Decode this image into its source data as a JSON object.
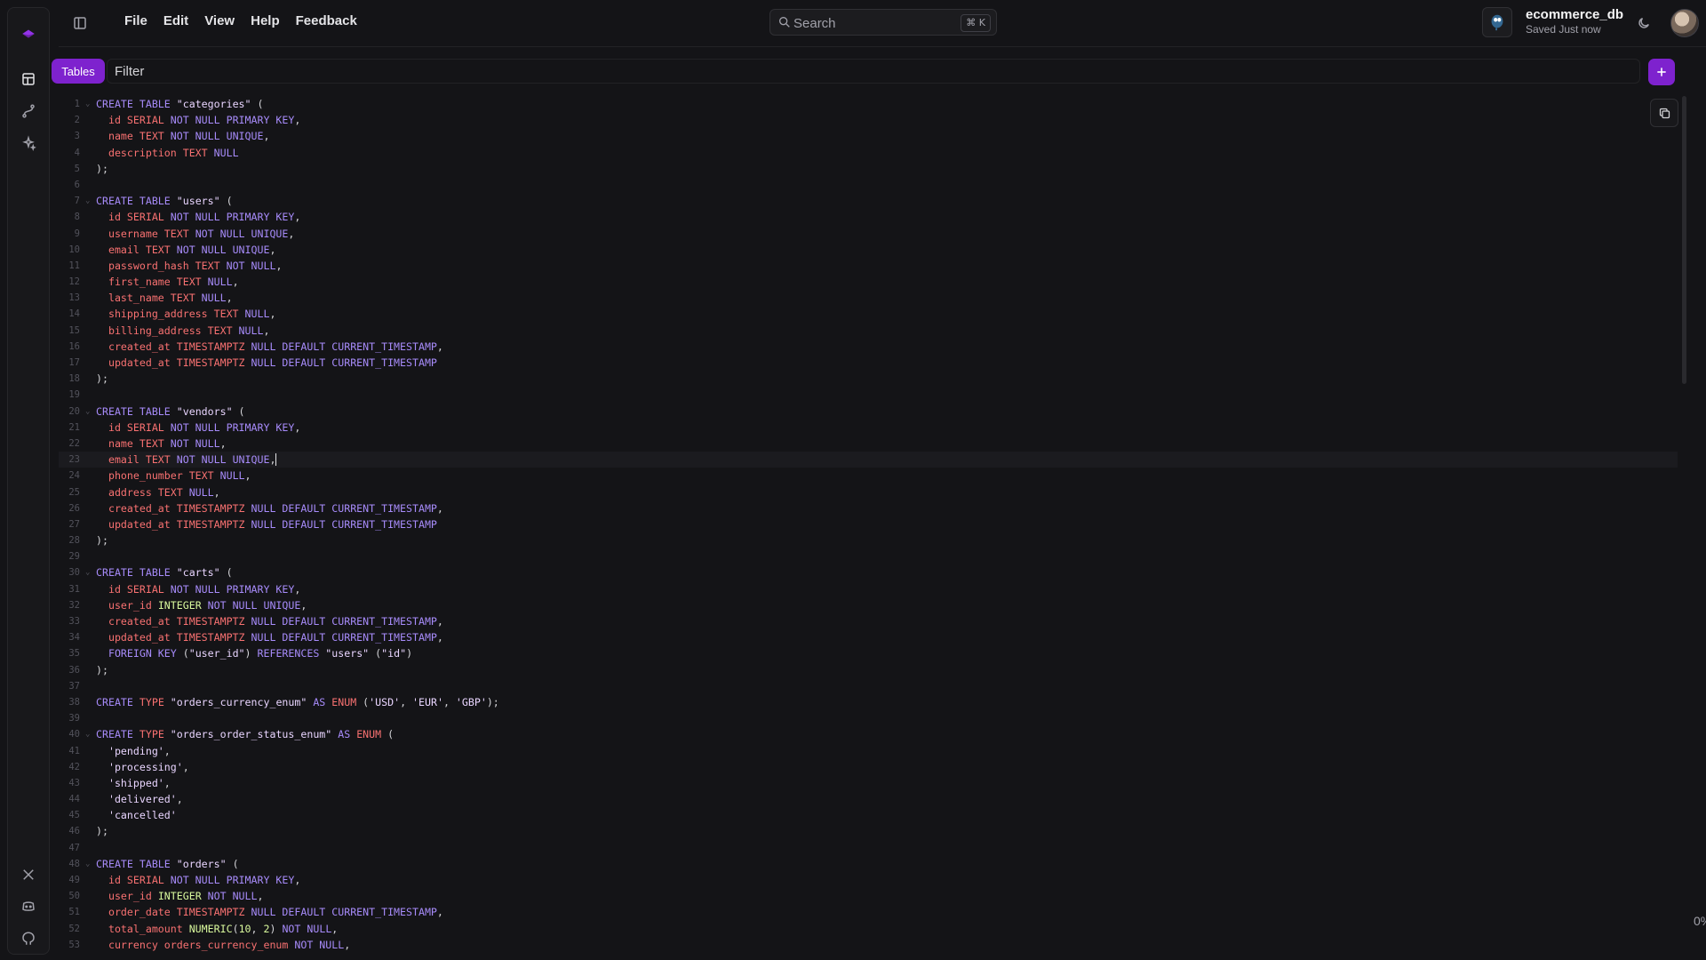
{
  "header": {
    "menu": [
      "File",
      "Edit",
      "View",
      "Help",
      "Feedback"
    ],
    "search": {
      "label": "Search",
      "shortcut": "⌘ K"
    },
    "db_name": "ecommerce_db",
    "db_status": "Saved Just now"
  },
  "filter": {
    "tab_label": "Tables",
    "placeholder": "Filter"
  },
  "edge_text": "0%",
  "colors": {
    "accent": "#7e22ce",
    "keyword": "#a78bfa",
    "identifier": "#f87171",
    "string": "#e9d5ff",
    "type": "#d9f99d"
  },
  "icons": {
    "rail": [
      "logo-icon",
      "table-icon",
      "route-icon",
      "sparkles-icon",
      "x-twitter-icon",
      "discord-icon",
      "github-icon"
    ],
    "header": [
      "sidebar-toggle-icon",
      "search-icon",
      "postgres-icon",
      "moon-icon"
    ],
    "editor": [
      "copy-icon",
      "plus-icon"
    ]
  },
  "editor": {
    "cursor_line": 23,
    "lines": [
      [
        [
          "k",
          "CREATE TABLE "
        ],
        [
          "s",
          "\"categories\""
        ],
        [
          "p",
          " ("
        ]
      ],
      [
        [
          "n",
          "  id SERIAL "
        ],
        [
          "k",
          "NOT NULL PRIMARY KEY"
        ],
        [
          "p",
          ","
        ]
      ],
      [
        [
          "n",
          "  name TEXT "
        ],
        [
          "k",
          "NOT NULL UNIQUE"
        ],
        [
          "p",
          ","
        ]
      ],
      [
        [
          "n",
          "  description TEXT "
        ],
        [
          "k",
          "NULL"
        ]
      ],
      [
        [
          "p",
          ");"
        ]
      ],
      [],
      [
        [
          "k",
          "CREATE TABLE "
        ],
        [
          "s",
          "\"users\""
        ],
        [
          "p",
          " ("
        ]
      ],
      [
        [
          "n",
          "  id SERIAL "
        ],
        [
          "k",
          "NOT NULL PRIMARY KEY"
        ],
        [
          "p",
          ","
        ]
      ],
      [
        [
          "n",
          "  username TEXT "
        ],
        [
          "k",
          "NOT NULL UNIQUE"
        ],
        [
          "p",
          ","
        ]
      ],
      [
        [
          "n",
          "  email TEXT "
        ],
        [
          "k",
          "NOT NULL UNIQUE"
        ],
        [
          "p",
          ","
        ]
      ],
      [
        [
          "n",
          "  password_hash TEXT "
        ],
        [
          "k",
          "NOT NULL"
        ],
        [
          "p",
          ","
        ]
      ],
      [
        [
          "n",
          "  first_name TEXT "
        ],
        [
          "k",
          "NULL"
        ],
        [
          "p",
          ","
        ]
      ],
      [
        [
          "n",
          "  last_name TEXT "
        ],
        [
          "k",
          "NULL"
        ],
        [
          "p",
          ","
        ]
      ],
      [
        [
          "n",
          "  shipping_address TEXT "
        ],
        [
          "k",
          "NULL"
        ],
        [
          "p",
          ","
        ]
      ],
      [
        [
          "n",
          "  billing_address TEXT "
        ],
        [
          "k",
          "NULL"
        ],
        [
          "p",
          ","
        ]
      ],
      [
        [
          "n",
          "  created_at TIMESTAMPTZ "
        ],
        [
          "k",
          "NULL DEFAULT CURRENT_TIMESTAMP"
        ],
        [
          "p",
          ","
        ]
      ],
      [
        [
          "n",
          "  updated_at TIMESTAMPTZ "
        ],
        [
          "k",
          "NULL DEFAULT CURRENT_TIMESTAMP"
        ]
      ],
      [
        [
          "p",
          ");"
        ]
      ],
      [],
      [
        [
          "k",
          "CREATE TABLE "
        ],
        [
          "s",
          "\"vendors\""
        ],
        [
          "p",
          " ("
        ]
      ],
      [
        [
          "n",
          "  id SERIAL "
        ],
        [
          "k",
          "NOT NULL PRIMARY KEY"
        ],
        [
          "p",
          ","
        ]
      ],
      [
        [
          "n",
          "  name TEXT "
        ],
        [
          "k",
          "NOT NULL"
        ],
        [
          "p",
          ","
        ]
      ],
      [
        [
          "n",
          "  email TEXT "
        ],
        [
          "k",
          "NOT NULL UNIQUE"
        ],
        [
          "p",
          ","
        ]
      ],
      [
        [
          "n",
          "  phone_number TEXT "
        ],
        [
          "k",
          "NULL"
        ],
        [
          "p",
          ","
        ]
      ],
      [
        [
          "n",
          "  address TEXT "
        ],
        [
          "k",
          "NULL"
        ],
        [
          "p",
          ","
        ]
      ],
      [
        [
          "n",
          "  created_at TIMESTAMPTZ "
        ],
        [
          "k",
          "NULL DEFAULT CURRENT_TIMESTAMP"
        ],
        [
          "p",
          ","
        ]
      ],
      [
        [
          "n",
          "  updated_at TIMESTAMPTZ "
        ],
        [
          "k",
          "NULL DEFAULT CURRENT_TIMESTAMP"
        ]
      ],
      [
        [
          "p",
          ");"
        ]
      ],
      [],
      [
        [
          "k",
          "CREATE TABLE "
        ],
        [
          "s",
          "\"carts\""
        ],
        [
          "p",
          " ("
        ]
      ],
      [
        [
          "n",
          "  id SERIAL "
        ],
        [
          "k",
          "NOT NULL PRIMARY KEY"
        ],
        [
          "p",
          ","
        ]
      ],
      [
        [
          "n",
          "  user_id "
        ],
        [
          "t",
          "INTEGER "
        ],
        [
          "k",
          "NOT NULL UNIQUE"
        ],
        [
          "p",
          ","
        ]
      ],
      [
        [
          "n",
          "  created_at TIMESTAMPTZ "
        ],
        [
          "k",
          "NULL DEFAULT CURRENT_TIMESTAMP"
        ],
        [
          "p",
          ","
        ]
      ],
      [
        [
          "n",
          "  updated_at TIMESTAMPTZ "
        ],
        [
          "k",
          "NULL DEFAULT CURRENT_TIMESTAMP"
        ],
        [
          "p",
          ","
        ]
      ],
      [
        [
          "k",
          "  FOREIGN KEY "
        ],
        [
          "p",
          "("
        ],
        [
          "s",
          "\"user_id\""
        ],
        [
          "p",
          ") "
        ],
        [
          "k",
          "REFERENCES "
        ],
        [
          "s",
          "\"users\""
        ],
        [
          "p",
          " ("
        ],
        [
          "s",
          "\"id\""
        ],
        [
          "p",
          ")"
        ]
      ],
      [
        [
          "p",
          ");"
        ]
      ],
      [],
      [
        [
          "k",
          "CREATE "
        ],
        [
          "n",
          "TYPE "
        ],
        [
          "s",
          "\"orders_currency_enum\""
        ],
        [
          "k",
          " AS "
        ],
        [
          "n",
          "ENUM "
        ],
        [
          "p",
          "("
        ],
        [
          "s",
          "'USD'"
        ],
        [
          "p",
          ", "
        ],
        [
          "s",
          "'EUR'"
        ],
        [
          "p",
          ", "
        ],
        [
          "s",
          "'GBP'"
        ],
        [
          "p",
          ");"
        ]
      ],
      [],
      [
        [
          "k",
          "CREATE "
        ],
        [
          "n",
          "TYPE "
        ],
        [
          "s",
          "\"orders_order_status_enum\""
        ],
        [
          "k",
          " AS "
        ],
        [
          "n",
          "ENUM "
        ],
        [
          "p",
          "("
        ]
      ],
      [
        [
          "s",
          "  'pending'"
        ],
        [
          "p",
          ","
        ]
      ],
      [
        [
          "s",
          "  'processing'"
        ],
        [
          "p",
          ","
        ]
      ],
      [
        [
          "s",
          "  'shipped'"
        ],
        [
          "p",
          ","
        ]
      ],
      [
        [
          "s",
          "  'delivered'"
        ],
        [
          "p",
          ","
        ]
      ],
      [
        [
          "s",
          "  'cancelled'"
        ]
      ],
      [
        [
          "p",
          ");"
        ]
      ],
      [],
      [
        [
          "k",
          "CREATE TABLE "
        ],
        [
          "s",
          "\"orders\""
        ],
        [
          "p",
          " ("
        ]
      ],
      [
        [
          "n",
          "  id SERIAL "
        ],
        [
          "k",
          "NOT NULL PRIMARY KEY"
        ],
        [
          "p",
          ","
        ]
      ],
      [
        [
          "n",
          "  user_id "
        ],
        [
          "t",
          "INTEGER "
        ],
        [
          "k",
          "NOT NULL"
        ],
        [
          "p",
          ","
        ]
      ],
      [
        [
          "n",
          "  order_date TIMESTAMPTZ "
        ],
        [
          "k",
          "NULL DEFAULT CURRENT_TIMESTAMP"
        ],
        [
          "p",
          ","
        ]
      ],
      [
        [
          "n",
          "  total_amount "
        ],
        [
          "t",
          "NUMERIC"
        ],
        [
          "p",
          "("
        ],
        [
          "t",
          "10"
        ],
        [
          "p",
          ", "
        ],
        [
          "t",
          "2"
        ],
        [
          "p",
          ") "
        ],
        [
          "k",
          "NOT NULL"
        ],
        [
          "p",
          ","
        ]
      ],
      [
        [
          "n",
          "  currency orders_currency_enum "
        ],
        [
          "k",
          "NOT NULL"
        ],
        [
          "p",
          ","
        ]
      ]
    ]
  }
}
